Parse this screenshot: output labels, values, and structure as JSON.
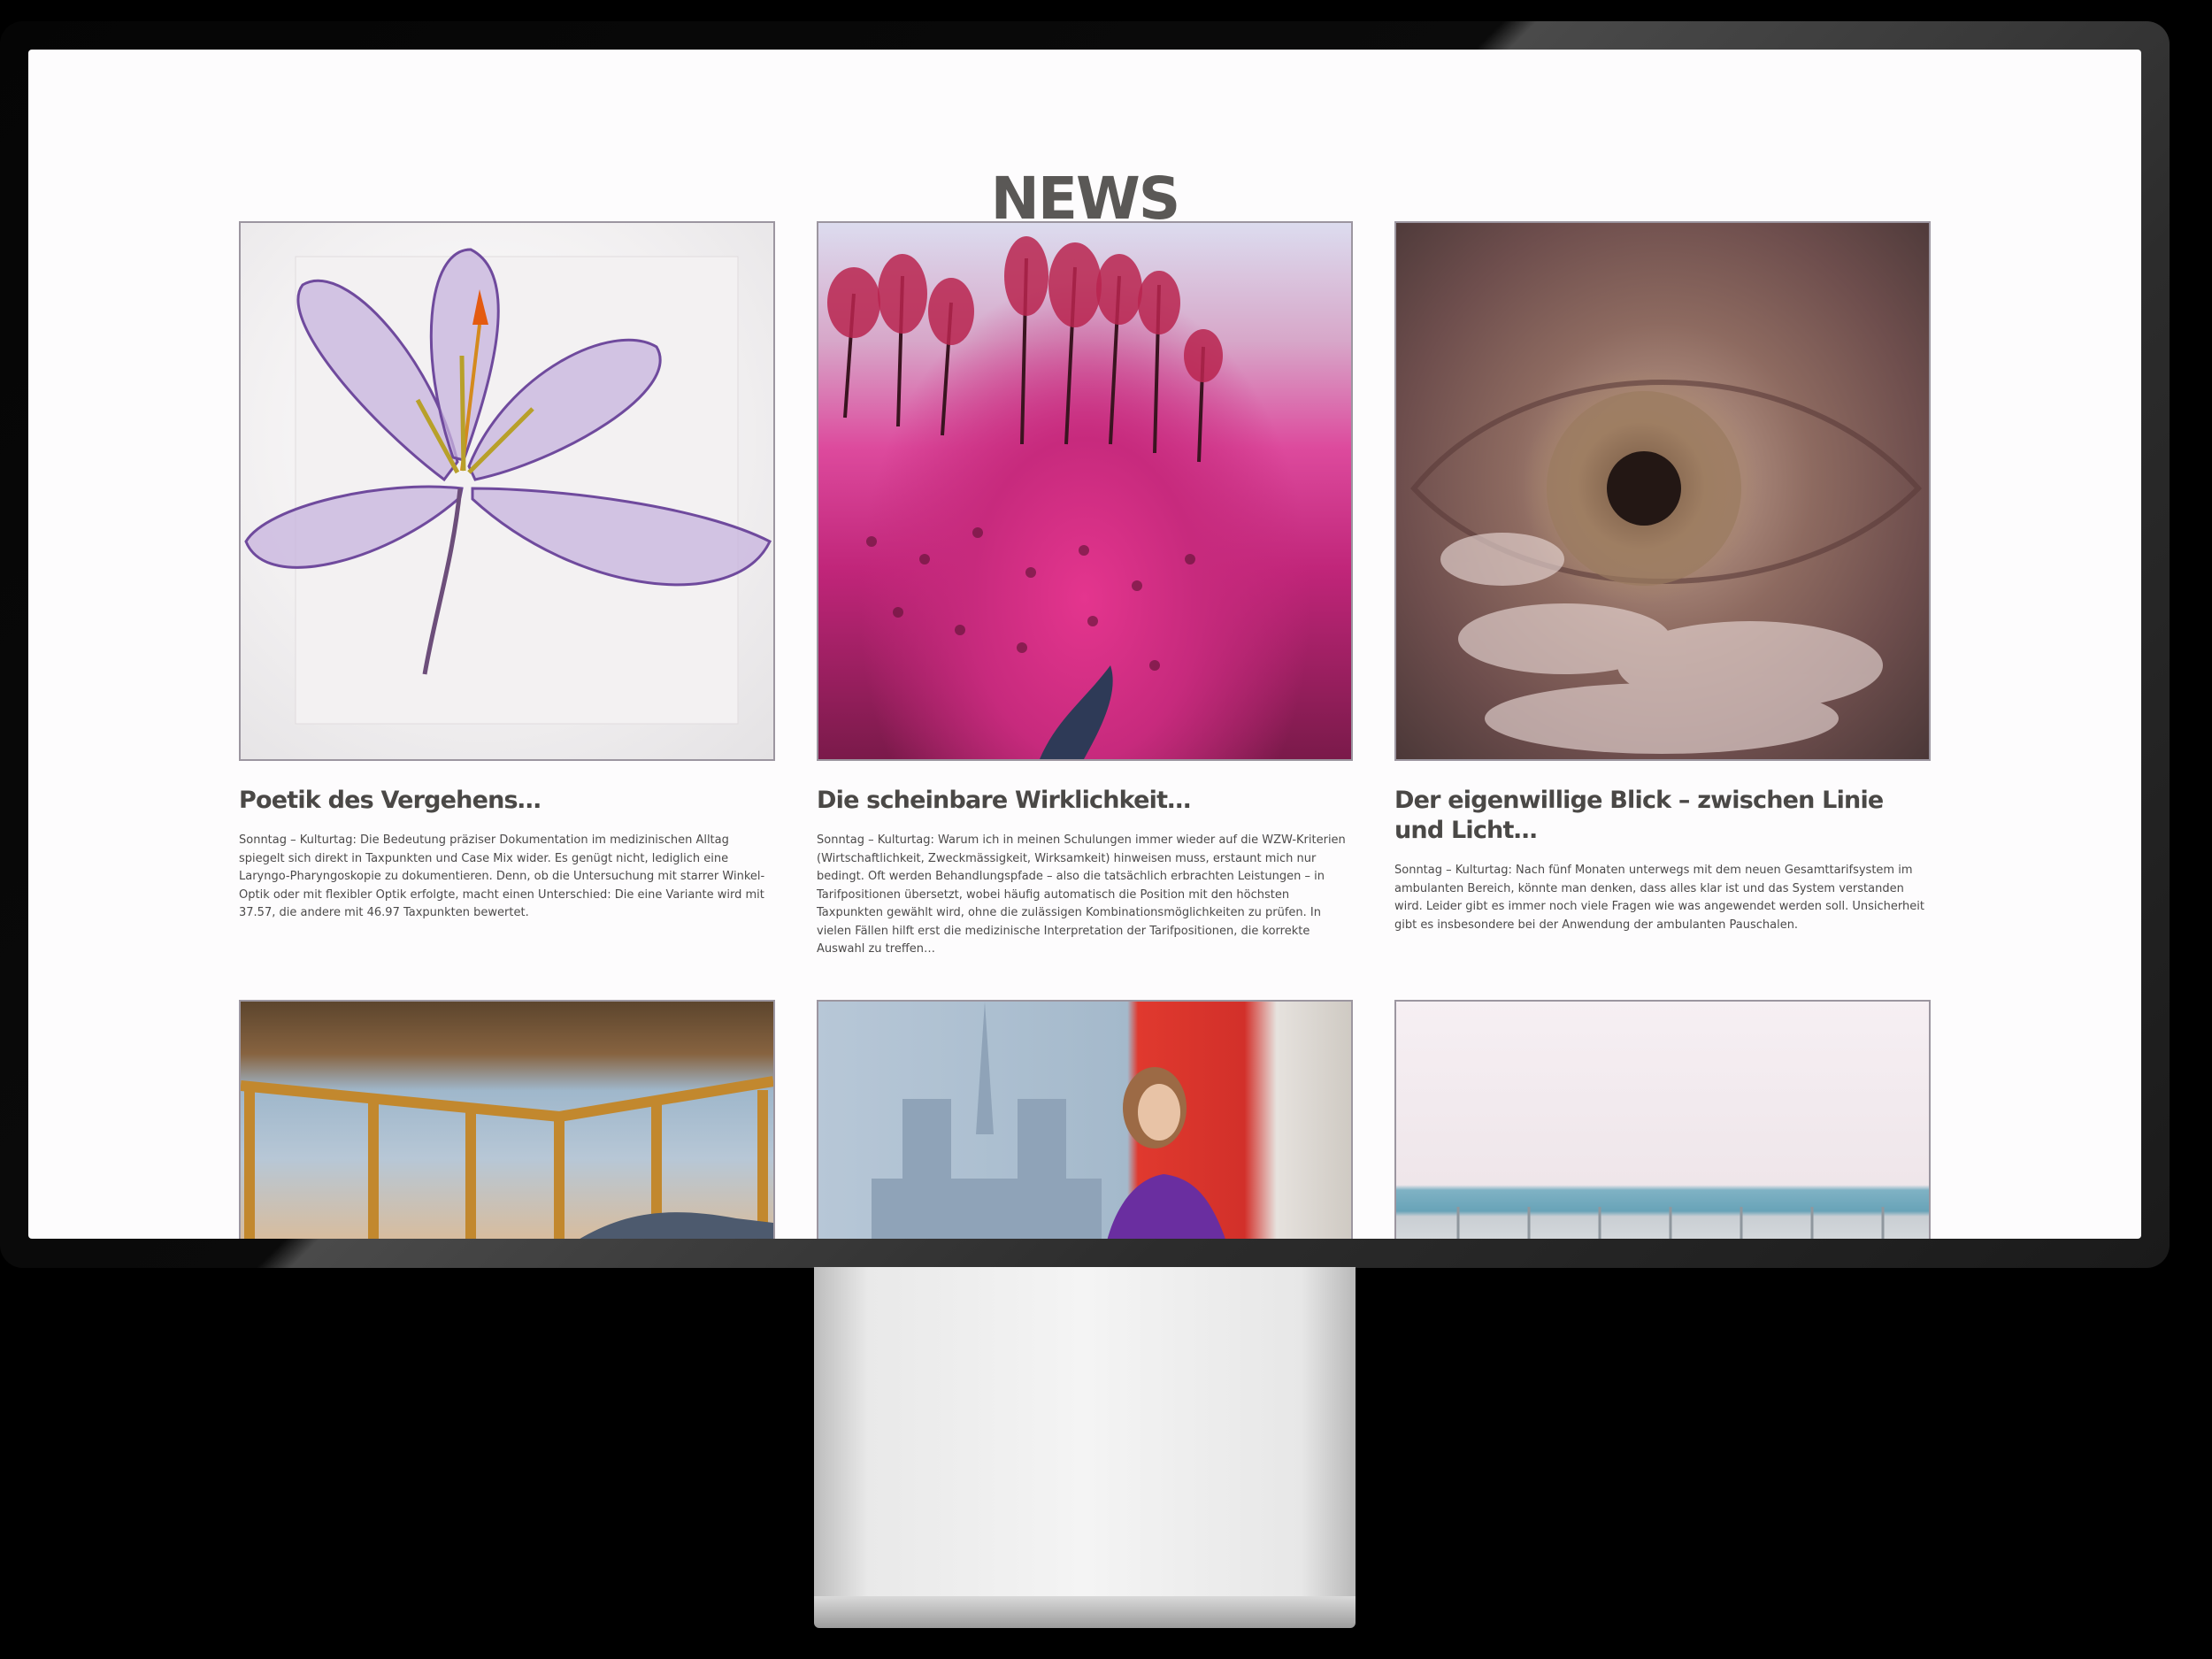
{
  "page": {
    "title": "NEWS"
  },
  "articles": [
    {
      "title": "Poetik des Vergehens…",
      "text": "Sonntag – Kulturtag: Die Bedeutung präziser Dokumentation im medizinischen Alltag spiegelt sich direkt in Taxpunkten und Case Mix wider. Es genügt nicht, lediglich eine Laryngo-Pharyngoskopie zu dokumentieren. Denn, ob die Untersuchung mit starrer Winkel-Optik oder mit flexibler Optik erfolgte, macht einen Unterschied: Die eine Variante wird mit 37.57, die andere mit 46.97 Taxpunkten bewertet.",
      "image": "pressed-crocus-flower"
    },
    {
      "title": "Die scheinbare Wirklichkeit…",
      "text": "Sonntag – Kulturtag: Warum ich in meinen Schulungen immer wieder auf die WZW-Kriterien (Wirtschaftlichkeit, Zweckmässigkeit, Wirksamkeit) hinweisen muss, erstaunt mich nur bedingt. Oft werden Behandlungspfade – also die tatsächlich erbrachten Leistungen – in Tarifpositionen übersetzt, wobei häufig automatisch die Position mit den höchsten Taxpunkten gewählt wird, ohne die zulässigen Kombinationsmöglichkeiten zu prüfen. In vielen Fällen hilft erst die medizinische Interpretation der Tarifpositionen, die korrekte Auswahl zu treffen…",
      "image": "pink-infrared-forest"
    },
    {
      "title": "Der eigenwillige Blick – zwischen Linie und Licht…",
      "text": "Sonntag – Kulturtag: Nach fünf Monaten unterwegs mit dem neuen Gesamttarifsystem im ambulanten Bereich, könnte man denken, dass alles klar ist und das System verstanden wird. Leider gibt es immer noch viele Fragen wie was angewendet werden soll. Unsicherheit gibt es insbesondere bei der Anwendung der ambulanten Pauschalen.",
      "image": "eye-with-clouds"
    },
    {
      "image": "room-with-windows"
    },
    {
      "image": "woman-notre-dame"
    },
    {
      "image": "rooftop-sky"
    }
  ],
  "colors": {
    "heading": "#5a5856",
    "card_title": "#4a4846",
    "body_text": "#4c4a4a",
    "screen_bg": "#fdfcfd",
    "frame": "#000000"
  }
}
